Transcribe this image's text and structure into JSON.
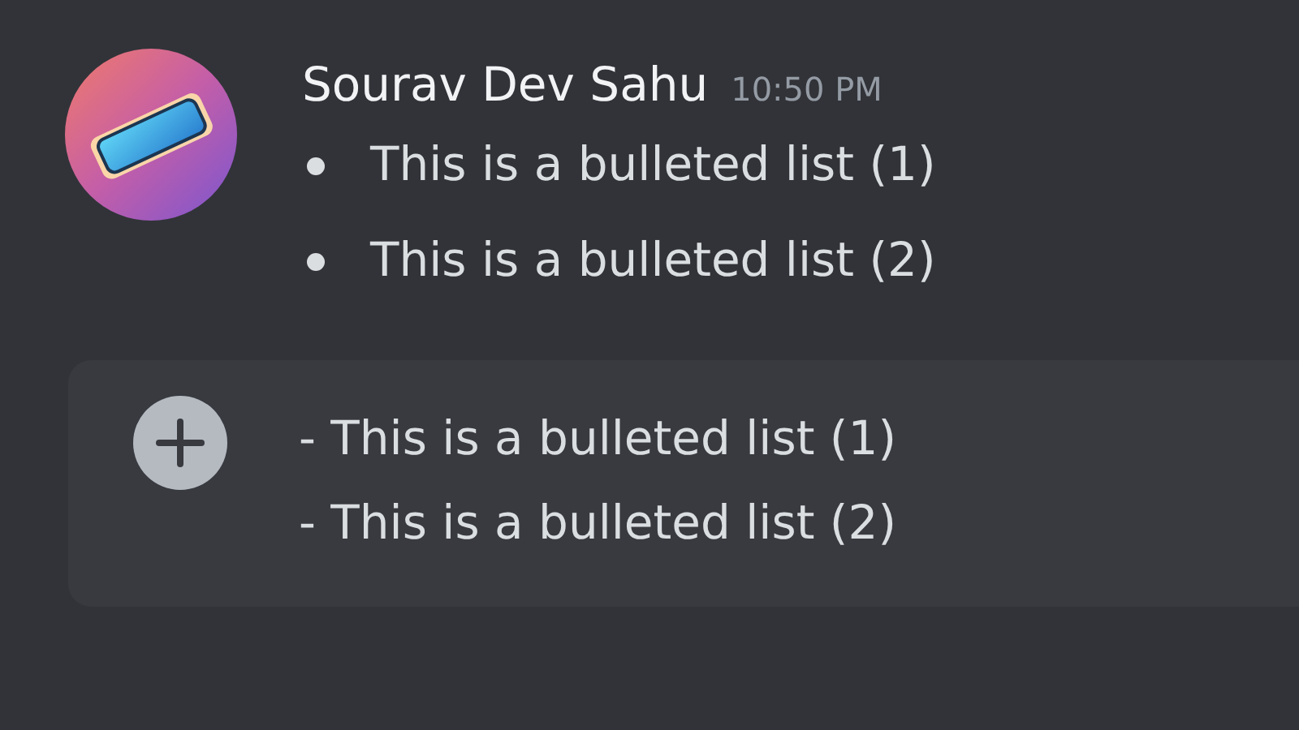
{
  "message": {
    "author": "Sourav Dev Sahu",
    "timestamp": "10:50 PM",
    "bullets": [
      "This is a bulleted list (1)",
      "This is a bulleted list (2)"
    ]
  },
  "composer": {
    "lines": [
      "- This is a bulleted list (1)",
      "- This is a bulleted list (2)"
    ]
  }
}
